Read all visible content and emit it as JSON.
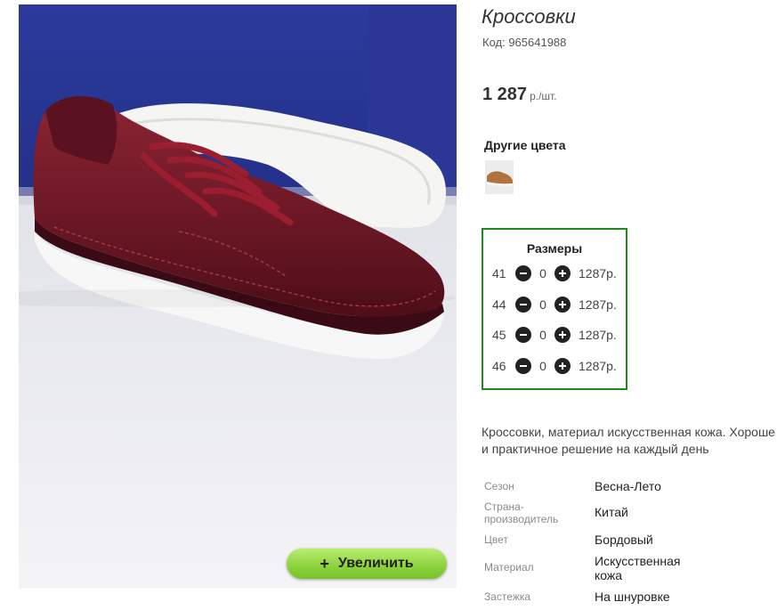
{
  "product": {
    "title": "Кроссовки",
    "code": "Код: 965641988",
    "price_amount": "1 287",
    "price_unit": "р./шт."
  },
  "photo": {
    "zoom_label": "Увеличить",
    "zoom_icon": "+"
  },
  "other_colors": {
    "title": "Другие цвета"
  },
  "sizes": {
    "title": "Размеры",
    "rows": [
      {
        "size": "41",
        "qty": "0",
        "price": "1287р."
      },
      {
        "size": "44",
        "qty": "0",
        "price": "1287р."
      },
      {
        "size": "45",
        "qty": "0",
        "price": "1287р."
      },
      {
        "size": "46",
        "qty": "0",
        "price": "1287р."
      }
    ]
  },
  "description": {
    "line1": "Кроссовки, материал искусственная кожа. Хороше",
    "line2": "и практичное решение на каждый день"
  },
  "specs": [
    {
      "label": "Сезон",
      "value": "Весна-Лето"
    },
    {
      "label": "Страна-производитель",
      "label_line1": "Страна-",
      "label_line2": "производитель",
      "value": "Китай"
    },
    {
      "label": "Цвет",
      "value": "Бордовый"
    },
    {
      "label": "Материал",
      "value": "Искусственная кожа",
      "value_line1": "Искусственная",
      "value_line2": "кожа"
    },
    {
      "label": "Застежка",
      "value": "На шнуровке"
    }
  ],
  "colors": {
    "accent_green": "#1e8a1e",
    "button_green": "#8fd33f",
    "shoe_burgundy": "#6b1622"
  }
}
